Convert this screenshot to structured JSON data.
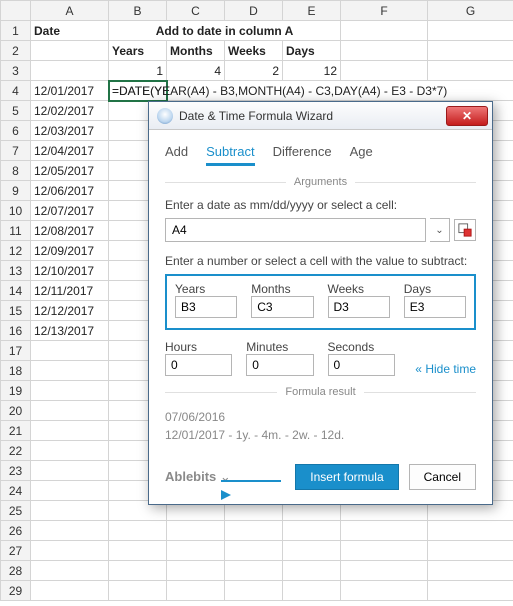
{
  "columns": [
    "",
    "A",
    "B",
    "C",
    "D",
    "E",
    "F",
    "G"
  ],
  "row1": {
    "A": "Date",
    "BCD": "Add to date in column A"
  },
  "row2": {
    "B": "Years",
    "C": "Months",
    "D": "Weeks",
    "E": "Days"
  },
  "row3": {
    "B": "1",
    "C": "4",
    "D": "2",
    "E": "12"
  },
  "dates": [
    "12/01/2017",
    "12/02/2017",
    "12/03/2017",
    "12/04/2017",
    "12/05/2017",
    "12/06/2017",
    "12/07/2017",
    "12/08/2017",
    "12/09/2017",
    "12/10/2017",
    "12/11/2017",
    "12/12/2017",
    "12/13/2017"
  ],
  "formula_display": "=DATE(YEAR(A4) - B3,MONTH(A4) - C3,DAY(A4) - E3 - D3*7)",
  "formula_prefix": "=DATE(YE",
  "dialog": {
    "title": "Date & Time Formula Wizard",
    "tabs": {
      "add": "Add",
      "subtract": "Subtract",
      "difference": "Difference",
      "age": "Age"
    },
    "args_label": "Arguments",
    "date_label": "Enter a date as mm/dd/yyyy or select a cell:",
    "date_value": "A4",
    "value_label": "Enter a number or select a cell with the value to subtract:",
    "fields": {
      "years": {
        "label": "Years",
        "value": "B3"
      },
      "months": {
        "label": "Months",
        "value": "C3"
      },
      "weeks": {
        "label": "Weeks",
        "value": "D3"
      },
      "days": {
        "label": "Days",
        "value": "E3"
      },
      "hours": {
        "label": "Hours",
        "value": "0"
      },
      "minutes": {
        "label": "Minutes",
        "value": "0"
      },
      "seconds": {
        "label": "Seconds",
        "value": "0"
      }
    },
    "hide_time": "Hide time",
    "result_label": "Formula result",
    "result_date": "07/06/2016",
    "result_expr": "12/01/2017 - 1y. - 4m. - 2w. - 12d.",
    "brand": "Ablebits",
    "insert": "Insert formula",
    "cancel": "Cancel"
  }
}
